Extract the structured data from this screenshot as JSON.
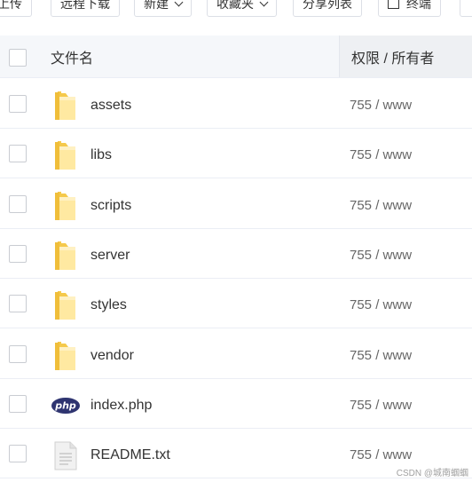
{
  "toolbar": {
    "buttons": [
      {
        "label": "上传"
      },
      {
        "label": "远程下载"
      },
      {
        "label": "新建"
      },
      {
        "label": "收藏夹"
      },
      {
        "label": "分享列表"
      },
      {
        "label": "终端"
      }
    ]
  },
  "table": {
    "headers": {
      "name": "文件名",
      "permission": "权限 / 所有者"
    },
    "rows": [
      {
        "name": "assets",
        "type": "folder",
        "permission": "755 / www"
      },
      {
        "name": "libs",
        "type": "folder",
        "permission": "755 / www"
      },
      {
        "name": "scripts",
        "type": "folder",
        "permission": "755 / www"
      },
      {
        "name": "server",
        "type": "folder",
        "permission": "755 / www"
      },
      {
        "name": "styles",
        "type": "folder",
        "permission": "755 / www"
      },
      {
        "name": "vendor",
        "type": "folder",
        "permission": "755 / www"
      },
      {
        "name": "index.php",
        "type": "php",
        "permission": "755 / www"
      },
      {
        "name": "README.txt",
        "type": "text",
        "permission": "755 / www"
      }
    ]
  },
  "icons": {
    "folder": "folder-icon",
    "php": "php-file-icon",
    "text": "text-file-icon",
    "php_label": "php"
  },
  "colors": {
    "folder_light": "#FFE9A1",
    "folder_dark": "#F5C94B",
    "php_badge": "#2E3470"
  },
  "watermark": "CSDN @城南蝈蝈"
}
